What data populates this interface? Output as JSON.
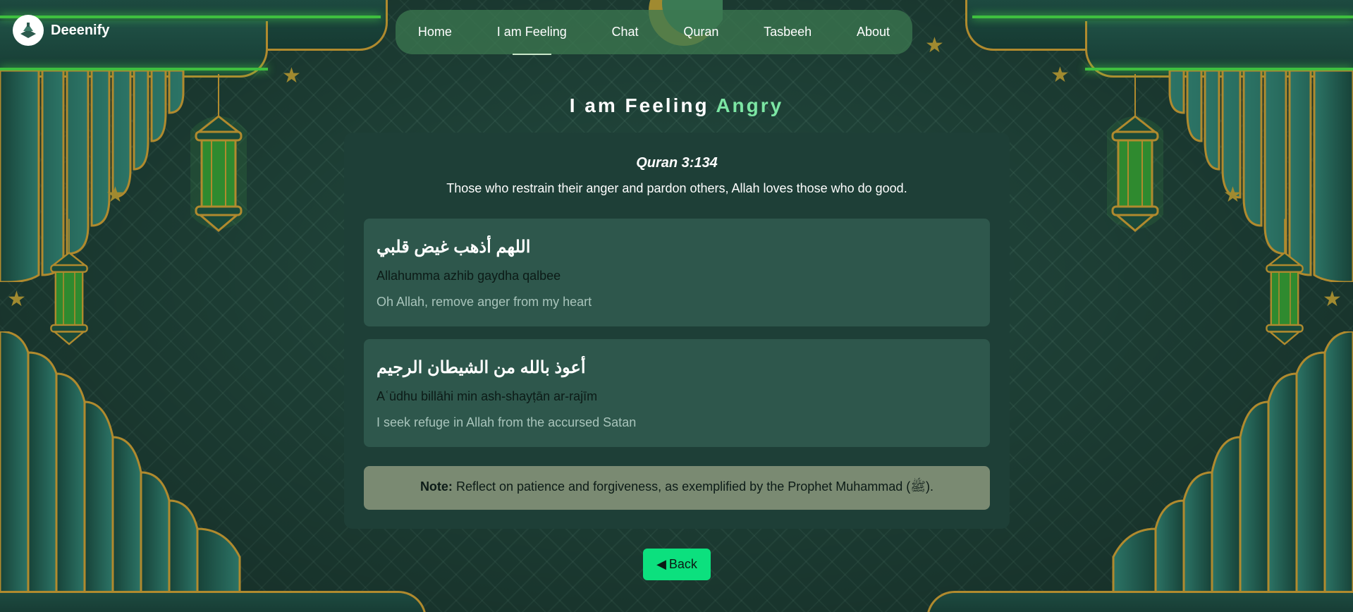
{
  "brand": {
    "name": "Deeenify"
  },
  "nav": {
    "items": [
      "Home",
      "I am Feeling",
      "Chat",
      "Quran",
      "Tasbeeh",
      "About"
    ],
    "active_index": 1
  },
  "page": {
    "title_prefix": "I am Feeling",
    "title_emotion": "Angry"
  },
  "quran": {
    "reference": "Quran 3:134",
    "verse": "Those who restrain their anger and pardon others, Allah loves those who do good."
  },
  "duas": [
    {
      "arabic": "اللهم أذهب غيض قلبي",
      "transliteration": "Allahumma azhib gaydha qalbee",
      "meaning": "Oh Allah, remove anger from my heart"
    },
    {
      "arabic": "أعوذ بالله من الشيطان الرجيم",
      "transliteration": "Aʿūdhu billāhi min ash-shayṭān ar-rajīm",
      "meaning": "I seek refuge in Allah from the accursed Satan"
    }
  ],
  "note": {
    "label": "Note:",
    "text": " Reflect on patience and forgiveness, as exemplified by the Prophet Muhammad (ﷺ)."
  },
  "back_button": {
    "icon": "◀",
    "label": "Back"
  },
  "colors": {
    "accent_green": "#0ce07e",
    "emotion": "#7ce6a4",
    "gold": "#b08a2e",
    "panel": "#1e3f37",
    "card": "#2e574c",
    "note_bg": "#7a8a72"
  }
}
